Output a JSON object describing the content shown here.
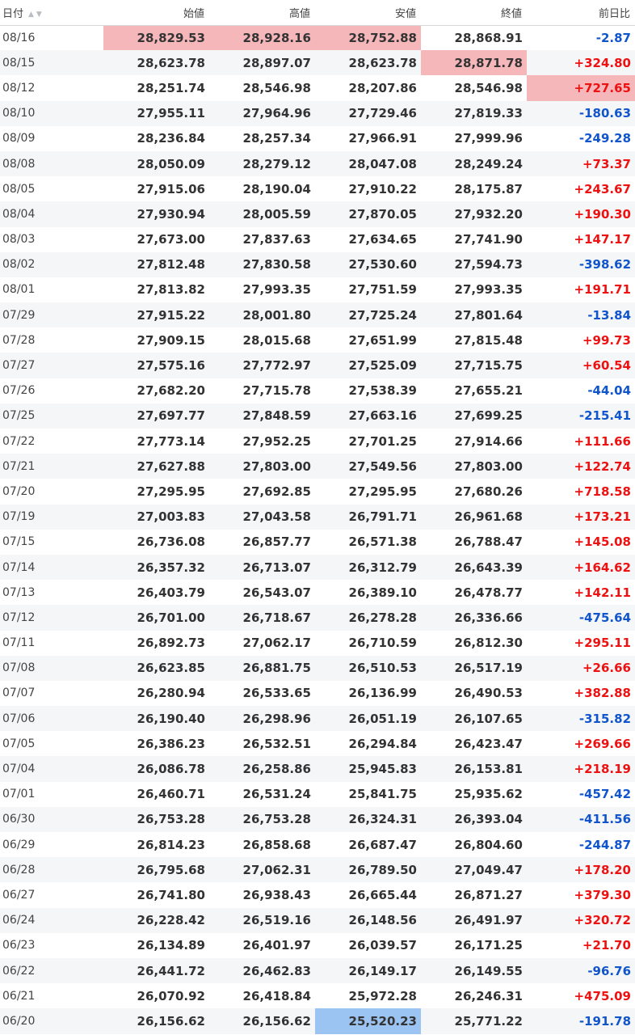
{
  "headers": {
    "date": "日付",
    "open": "始値",
    "high": "高値",
    "low": "安値",
    "close": "終値",
    "change": "前日比"
  },
  "sort_indicator": "▲▼",
  "colors": {
    "up": "#ee1111",
    "down": "#1155cc",
    "highlight_high": "#f6b7bb",
    "highlight_low": "#9cc4f2"
  },
  "rows": [
    {
      "date": "08/16",
      "open": "28,829.53",
      "high": "28,928.16",
      "low": "28,752.88",
      "close": "28,868.91",
      "change": "-2.87",
      "hl": [
        "open",
        "high",
        "low"
      ]
    },
    {
      "date": "08/15",
      "open": "28,623.78",
      "high": "28,897.07",
      "low": "28,623.78",
      "close": "28,871.78",
      "change": "+324.80",
      "hl": [
        "close"
      ]
    },
    {
      "date": "08/12",
      "open": "28,251.74",
      "high": "28,546.98",
      "low": "28,207.86",
      "close": "28,546.98",
      "change": "+727.65",
      "hl": [
        "change"
      ]
    },
    {
      "date": "08/10",
      "open": "27,955.11",
      "high": "27,964.96",
      "low": "27,729.46",
      "close": "27,819.33",
      "change": "-180.63"
    },
    {
      "date": "08/09",
      "open": "28,236.84",
      "high": "28,257.34",
      "low": "27,966.91",
      "close": "27,999.96",
      "change": "-249.28"
    },
    {
      "date": "08/08",
      "open": "28,050.09",
      "high": "28,279.12",
      "low": "28,047.08",
      "close": "28,249.24",
      "change": "+73.37"
    },
    {
      "date": "08/05",
      "open": "27,915.06",
      "high": "28,190.04",
      "low": "27,910.22",
      "close": "28,175.87",
      "change": "+243.67"
    },
    {
      "date": "08/04",
      "open": "27,930.94",
      "high": "28,005.59",
      "low": "27,870.05",
      "close": "27,932.20",
      "change": "+190.30"
    },
    {
      "date": "08/03",
      "open": "27,673.00",
      "high": "27,837.63",
      "low": "27,634.65",
      "close": "27,741.90",
      "change": "+147.17"
    },
    {
      "date": "08/02",
      "open": "27,812.48",
      "high": "27,830.58",
      "low": "27,530.60",
      "close": "27,594.73",
      "change": "-398.62"
    },
    {
      "date": "08/01",
      "open": "27,813.82",
      "high": "27,993.35",
      "low": "27,751.59",
      "close": "27,993.35",
      "change": "+191.71"
    },
    {
      "date": "07/29",
      "open": "27,915.22",
      "high": "28,001.80",
      "low": "27,725.24",
      "close": "27,801.64",
      "change": "-13.84"
    },
    {
      "date": "07/28",
      "open": "27,909.15",
      "high": "28,015.68",
      "low": "27,651.99",
      "close": "27,815.48",
      "change": "+99.73"
    },
    {
      "date": "07/27",
      "open": "27,575.16",
      "high": "27,772.97",
      "low": "27,525.09",
      "close": "27,715.75",
      "change": "+60.54"
    },
    {
      "date": "07/26",
      "open": "27,682.20",
      "high": "27,715.78",
      "low": "27,538.39",
      "close": "27,655.21",
      "change": "-44.04"
    },
    {
      "date": "07/25",
      "open": "27,697.77",
      "high": "27,848.59",
      "low": "27,663.16",
      "close": "27,699.25",
      "change": "-215.41"
    },
    {
      "date": "07/22",
      "open": "27,773.14",
      "high": "27,952.25",
      "low": "27,701.25",
      "close": "27,914.66",
      "change": "+111.66"
    },
    {
      "date": "07/21",
      "open": "27,627.88",
      "high": "27,803.00",
      "low": "27,549.56",
      "close": "27,803.00",
      "change": "+122.74"
    },
    {
      "date": "07/20",
      "open": "27,295.95",
      "high": "27,692.85",
      "low": "27,295.95",
      "close": "27,680.26",
      "change": "+718.58"
    },
    {
      "date": "07/19",
      "open": "27,003.83",
      "high": "27,043.58",
      "low": "26,791.71",
      "close": "26,961.68",
      "change": "+173.21"
    },
    {
      "date": "07/15",
      "open": "26,736.08",
      "high": "26,857.77",
      "low": "26,571.38",
      "close": "26,788.47",
      "change": "+145.08"
    },
    {
      "date": "07/14",
      "open": "26,357.32",
      "high": "26,713.07",
      "low": "26,312.79",
      "close": "26,643.39",
      "change": "+164.62"
    },
    {
      "date": "07/13",
      "open": "26,403.79",
      "high": "26,543.07",
      "low": "26,389.10",
      "close": "26,478.77",
      "change": "+142.11"
    },
    {
      "date": "07/12",
      "open": "26,701.00",
      "high": "26,718.67",
      "low": "26,278.28",
      "close": "26,336.66",
      "change": "-475.64"
    },
    {
      "date": "07/11",
      "open": "26,892.73",
      "high": "27,062.17",
      "low": "26,710.59",
      "close": "26,812.30",
      "change": "+295.11"
    },
    {
      "date": "07/08",
      "open": "26,623.85",
      "high": "26,881.75",
      "low": "26,510.53",
      "close": "26,517.19",
      "change": "+26.66"
    },
    {
      "date": "07/07",
      "open": "26,280.94",
      "high": "26,533.65",
      "low": "26,136.99",
      "close": "26,490.53",
      "change": "+382.88"
    },
    {
      "date": "07/06",
      "open": "26,190.40",
      "high": "26,298.96",
      "low": "26,051.19",
      "close": "26,107.65",
      "change": "-315.82"
    },
    {
      "date": "07/05",
      "open": "26,386.23",
      "high": "26,532.51",
      "low": "26,294.84",
      "close": "26,423.47",
      "change": "+269.66"
    },
    {
      "date": "07/04",
      "open": "26,086.78",
      "high": "26,258.86",
      "low": "25,945.83",
      "close": "26,153.81",
      "change": "+218.19"
    },
    {
      "date": "07/01",
      "open": "26,460.71",
      "high": "26,531.24",
      "low": "25,841.75",
      "close": "25,935.62",
      "change": "-457.42"
    },
    {
      "date": "06/30",
      "open": "26,753.28",
      "high": "26,753.28",
      "low": "26,324.31",
      "close": "26,393.04",
      "change": "-411.56"
    },
    {
      "date": "06/29",
      "open": "26,814.23",
      "high": "26,858.68",
      "low": "26,687.47",
      "close": "26,804.60",
      "change": "-244.87"
    },
    {
      "date": "06/28",
      "open": "26,795.68",
      "high": "27,062.31",
      "low": "26,789.50",
      "close": "27,049.47",
      "change": "+178.20"
    },
    {
      "date": "06/27",
      "open": "26,741.80",
      "high": "26,938.43",
      "low": "26,665.44",
      "close": "26,871.27",
      "change": "+379.30"
    },
    {
      "date": "06/24",
      "open": "26,228.42",
      "high": "26,519.16",
      "low": "26,148.56",
      "close": "26,491.97",
      "change": "+320.72"
    },
    {
      "date": "06/23",
      "open": "26,134.89",
      "high": "26,401.97",
      "low": "26,039.57",
      "close": "26,171.25",
      "change": "+21.70"
    },
    {
      "date": "06/22",
      "open": "26,441.72",
      "high": "26,462.83",
      "low": "26,149.17",
      "close": "26,149.55",
      "change": "-96.76"
    },
    {
      "date": "06/21",
      "open": "26,070.92",
      "high": "26,418.84",
      "low": "25,972.28",
      "close": "26,246.31",
      "change": "+475.09"
    },
    {
      "date": "06/20",
      "open": "26,156.62",
      "high": "26,156.62",
      "low": "25,520.23",
      "close": "25,771.22",
      "change": "-191.78",
      "hl_low": [
        "low"
      ]
    }
  ]
}
